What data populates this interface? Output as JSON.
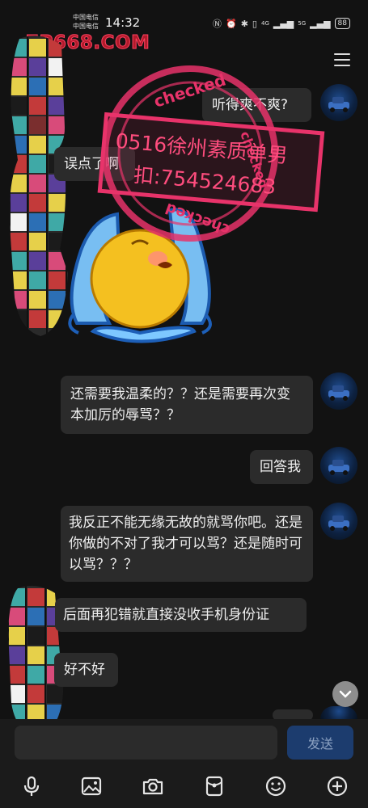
{
  "status_bar": {
    "carrier_1": "中国电信",
    "carrier_2": "中国电信",
    "time": "14:32",
    "network_1": "4G",
    "network_2": "5G",
    "battery": "88"
  },
  "header": {
    "watermark_url": "7P668.COM"
  },
  "stamp": {
    "ring_text": "checked",
    "line_1": "0516徐州素质单男",
    "line_2": "扣:754524683"
  },
  "messages": {
    "m1": "听得爽不爽?",
    "m2": "误点了啊",
    "m3": "还需要我温柔的？？还是需要再次变本加厉的辱骂？？",
    "m4": "回答我",
    "m5": "我反正不能无缘无故的就骂你吧。还是你做的不对了我才可以骂？还是随时可以骂？？？",
    "m6": "后面再犯错就直接没收手机身份证",
    "m7": "好不好"
  },
  "input": {
    "placeholder": "",
    "send_label": "发送"
  },
  "colors": {
    "background": "#121212",
    "bubble": "#2b2b2b",
    "send_button": "#1c3c6e",
    "stamp": "#e8336a"
  },
  "icons": {
    "menu": "menu-icon",
    "scroll_down": "chevron-down-icon",
    "toolbar": [
      "microphone-icon",
      "image-icon",
      "camera-icon",
      "red-packet-icon",
      "emoji-icon",
      "add-icon"
    ]
  }
}
